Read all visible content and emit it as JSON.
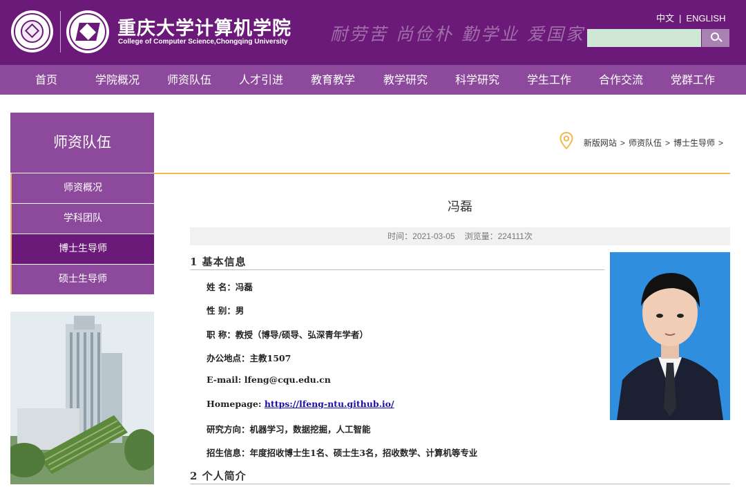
{
  "header": {
    "cn_name": "重庆大学计算机学院",
    "en_name": "College of Computer Science,Chongqing University",
    "motto": "耐劳苦 尚俭朴 勤学业 爱国家",
    "lang_zh": "中文",
    "lang_sep": "|",
    "lang_en": "ENGLISH",
    "search_placeholder": ""
  },
  "nav": {
    "items": [
      "首页",
      "学院概况",
      "师资队伍",
      "人才引进",
      "教育教学",
      "教学研究",
      "科学研究",
      "学生工作",
      "合作交流",
      "党群工作"
    ]
  },
  "sidebar": {
    "title": "师资队伍",
    "items": [
      "师资概况",
      "学科团队",
      "博士生导师",
      "硕士生导师"
    ],
    "active_index": 2
  },
  "breadcrumb": {
    "items": [
      "新版网站",
      "师资队伍",
      "博士生导师"
    ],
    "sep": ">"
  },
  "article": {
    "title": "冯磊",
    "time": "时间：2021-03-05",
    "views": "浏览量：224111次",
    "section1": "1 基本信息",
    "name_label": "姓 名：",
    "name_value": "冯磊",
    "gender_label": "性 别：",
    "gender_value": "男",
    "title_label": "职 称：",
    "title_value": "教授（博导/硕导、弘深青年学者）",
    "office_label": "办公地点：",
    "office_value": "主教1507",
    "email_label": "E-mail: ",
    "email_value": "lfeng@cqu.edu.cn",
    "homepage_label": "Homepage: ",
    "homepage_value": "https://lfeng-ntu.github.io/",
    "research_label": "研究方向：",
    "research_value": "机器学习，数据挖掘，人工智能",
    "recruit_label": "招生信息：",
    "recruit_value": "年度招收博士生1名、硕士生3名，招收数学、计算机等专业",
    "section2": "2 个人简介"
  },
  "colors": {
    "header_bg": "#6c1a79",
    "nav_bg": "#8d4a9c",
    "accent_gold": "#f2b84b",
    "photo_bg": "#2f8fde"
  }
}
